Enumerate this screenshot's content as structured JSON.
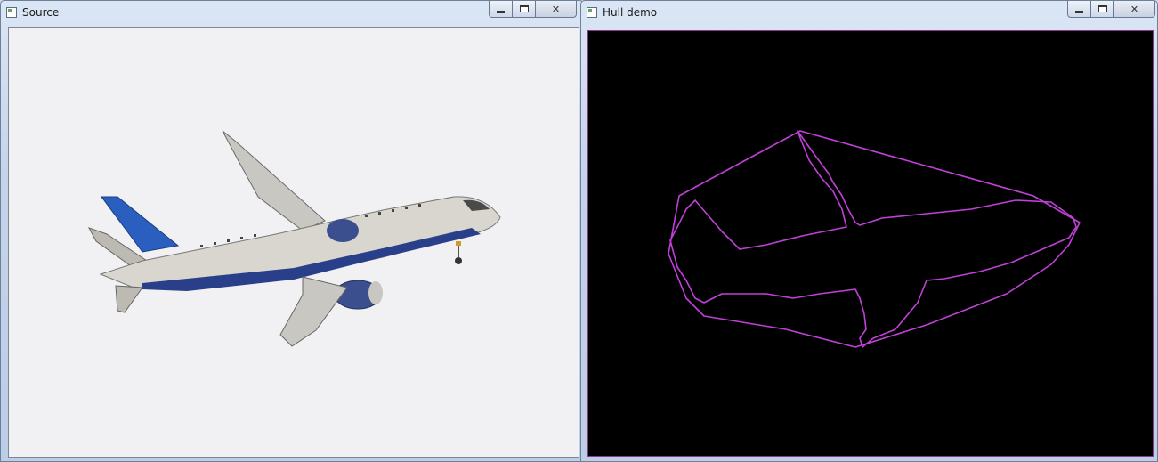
{
  "windows": {
    "source": {
      "title": "Source",
      "controls": {
        "minimize": "minimize-button",
        "maximize": "maximize-button",
        "close": "close-button"
      }
    },
    "hull": {
      "title": "Hull demo",
      "controls": {
        "minimize": "minimize-button",
        "maximize": "maximize-button",
        "close": "close-button"
      }
    }
  },
  "colors": {
    "hull_stroke": "#c040d8",
    "hull_background": "#000000",
    "source_background": "#f2f2f4",
    "tail_blue": "#2a5fbf",
    "fuselage": "#d8d6cf",
    "belly_blue": "#2a3f8a"
  },
  "glyphs": {
    "close": "✕"
  }
}
